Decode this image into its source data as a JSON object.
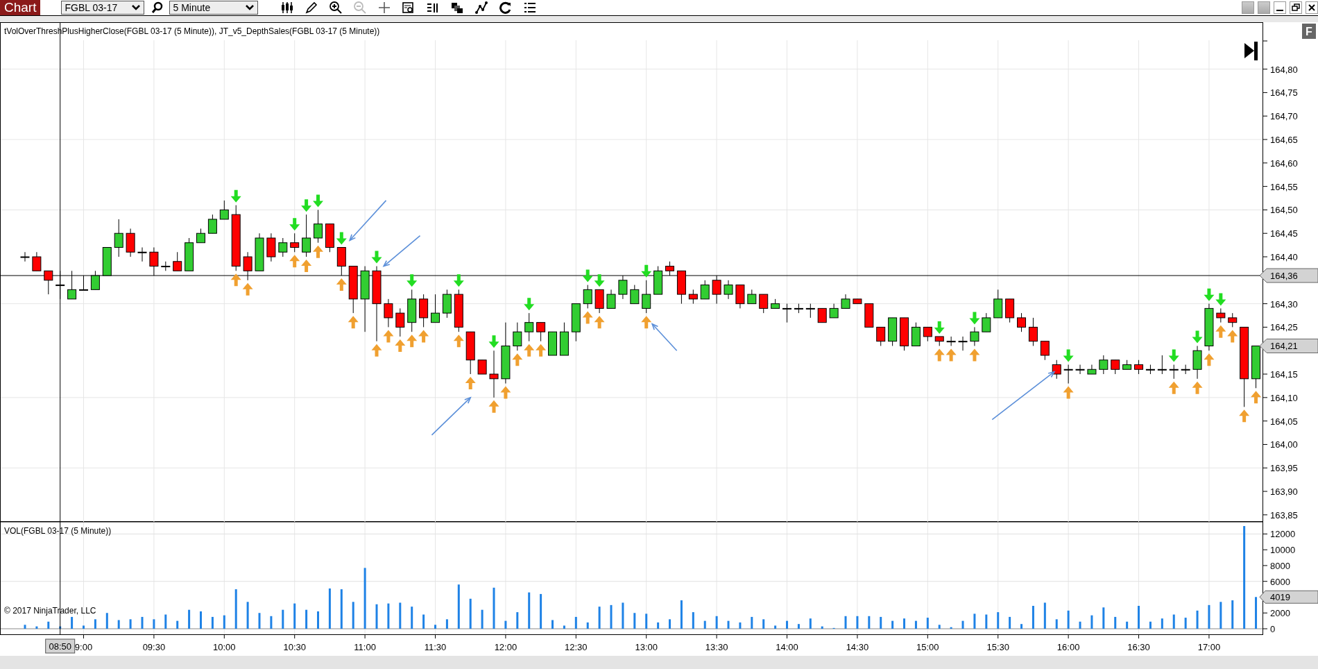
{
  "toolbar": {
    "tab": "Chart",
    "instrument": "FGBL 03-17",
    "interval": "5 Minute",
    "zoom_out_disabled": true
  },
  "badge": "F",
  "price_panel": {
    "title": "tVolOverThreshPlusHigherClose(FGBL 03-17 (5 Minute)), JT_v5_DepthSales(FGBL 03-17 (5 Minute))",
    "last_price_label": "164,21",
    "signal_down": [
      false,
      false,
      false,
      false,
      false,
      false,
      false,
      false,
      false,
      false,
      false,
      false,
      false,
      false,
      false,
      false,
      false,
      false,
      true,
      false,
      false,
      false,
      false,
      true,
      true,
      true,
      false,
      true,
      false,
      false,
      true,
      false,
      false,
      true,
      false,
      false,
      false,
      true,
      false,
      false,
      true,
      false,
      false,
      true,
      false,
      false,
      false,
      false,
      true,
      true,
      false,
      false,
      false,
      true,
      false,
      false,
      false,
      false,
      false,
      false,
      false,
      false,
      false,
      false,
      false,
      false,
      false,
      false,
      false,
      false,
      false,
      false,
      false,
      false,
      false,
      false,
      false,
      false,
      true,
      false,
      false,
      true,
      false,
      false,
      false,
      false,
      false,
      false,
      false,
      true,
      false,
      false,
      false,
      false,
      false,
      false,
      false,
      false,
      true,
      false,
      true,
      true,
      true,
      false,
      false,
      false
    ],
    "signal_up": [
      false,
      false,
      false,
      false,
      false,
      false,
      false,
      false,
      false,
      false,
      false,
      false,
      false,
      false,
      false,
      false,
      false,
      false,
      true,
      true,
      false,
      false,
      false,
      true,
      true,
      true,
      false,
      true,
      true,
      false,
      true,
      true,
      true,
      true,
      true,
      false,
      false,
      true,
      true,
      false,
      true,
      true,
      true,
      true,
      true,
      false,
      false,
      false,
      true,
      true,
      false,
      false,
      false,
      true,
      false,
      false,
      false,
      false,
      false,
      false,
      false,
      false,
      false,
      false,
      false,
      false,
      false,
      false,
      false,
      false,
      false,
      false,
      false,
      false,
      false,
      false,
      false,
      false,
      true,
      true,
      false,
      true,
      false,
      false,
      false,
      false,
      false,
      false,
      false,
      true,
      false,
      false,
      false,
      false,
      false,
      false,
      false,
      false,
      true,
      false,
      true,
      true,
      true,
      true,
      true,
      true
    ],
    "chart_data": {
      "type": "candlestick",
      "grid": true,
      "ylim": [
        163.835,
        164.9
      ],
      "x": [
        515,
        520,
        525,
        530,
        535,
        540,
        545,
        550,
        555,
        560,
        565,
        570,
        575,
        580,
        585,
        590,
        595,
        600,
        605,
        610,
        615,
        620,
        625,
        630,
        635,
        640,
        645,
        650,
        655,
        660,
        665,
        670,
        675,
        680,
        685,
        690,
        695,
        700,
        705,
        710,
        715,
        720,
        725,
        730,
        735,
        740,
        745,
        750,
        755,
        760,
        765,
        770,
        775,
        780,
        785,
        790,
        795,
        800,
        805,
        810,
        815,
        820,
        825,
        830,
        835,
        840,
        845,
        850,
        855,
        860,
        865,
        870,
        875,
        880,
        885,
        890,
        895,
        900,
        905,
        910,
        915,
        920,
        925,
        930,
        935,
        940,
        945,
        950,
        955,
        960,
        965,
        970,
        975,
        980,
        985,
        990,
        995,
        1000,
        1005,
        1010,
        1015,
        1020,
        1025,
        1030,
        1035,
        1040
      ],
      "ohlc": [
        [
          164.4,
          164.41,
          164.39,
          164.4
        ],
        [
          164.4,
          164.41,
          164.37,
          164.37
        ],
        [
          164.37,
          164.37,
          164.32,
          164.35
        ],
        [
          164.34,
          164.37,
          164.31,
          164.34
        ],
        [
          164.31,
          164.37,
          164.31,
          164.33
        ],
        [
          164.33,
          164.36,
          164.33,
          164.33
        ],
        [
          164.33,
          164.37,
          164.33,
          164.36
        ],
        [
          164.36,
          164.42,
          164.36,
          164.42
        ],
        [
          164.42,
          164.48,
          164.4,
          164.45
        ],
        [
          164.45,
          164.46,
          164.4,
          164.41
        ],
        [
          164.41,
          164.42,
          164.39,
          164.41
        ],
        [
          164.41,
          164.42,
          164.36,
          164.38
        ],
        [
          164.38,
          164.39,
          164.37,
          164.38
        ],
        [
          164.39,
          164.41,
          164.37,
          164.37
        ],
        [
          164.37,
          164.44,
          164.37,
          164.43
        ],
        [
          164.43,
          164.46,
          164.43,
          164.45
        ],
        [
          164.45,
          164.49,
          164.45,
          164.48
        ],
        [
          164.48,
          164.52,
          164.48,
          164.5
        ],
        [
          164.49,
          164.51,
          164.37,
          164.38
        ],
        [
          164.4,
          164.41,
          164.35,
          164.37
        ],
        [
          164.37,
          164.45,
          164.37,
          164.44
        ],
        [
          164.44,
          164.45,
          164.39,
          164.4
        ],
        [
          164.41,
          164.44,
          164.4,
          164.43
        ],
        [
          164.43,
          164.45,
          164.41,
          164.42
        ],
        [
          164.41,
          164.49,
          164.4,
          164.44
        ],
        [
          164.44,
          164.5,
          164.43,
          164.47
        ],
        [
          164.47,
          164.47,
          164.41,
          164.42
        ],
        [
          164.42,
          164.42,
          164.36,
          164.38
        ],
        [
          164.38,
          164.38,
          164.28,
          164.31
        ],
        [
          164.31,
          164.38,
          164.24,
          164.37
        ],
        [
          164.37,
          164.38,
          164.22,
          164.3
        ],
        [
          164.3,
          164.31,
          164.25,
          164.27
        ],
        [
          164.28,
          164.29,
          164.23,
          164.25
        ],
        [
          164.26,
          164.33,
          164.24,
          164.31
        ],
        [
          164.31,
          164.32,
          164.25,
          164.27
        ],
        [
          164.26,
          164.32,
          164.26,
          164.28
        ],
        [
          164.28,
          164.33,
          164.27,
          164.32
        ],
        [
          164.32,
          164.33,
          164.24,
          164.25
        ],
        [
          164.24,
          164.24,
          164.15,
          164.18
        ],
        [
          164.18,
          164.18,
          164.15,
          164.15
        ],
        [
          164.15,
          164.2,
          164.1,
          164.14
        ],
        [
          164.14,
          164.26,
          164.13,
          164.21
        ],
        [
          164.21,
          164.26,
          164.2,
          164.24
        ],
        [
          164.24,
          164.28,
          164.22,
          164.26
        ],
        [
          164.26,
          164.26,
          164.22,
          164.24
        ],
        [
          164.19,
          164.24,
          164.19,
          164.24
        ],
        [
          164.19,
          164.26,
          164.19,
          164.24
        ],
        [
          164.24,
          164.3,
          164.22,
          164.3
        ],
        [
          164.3,
          164.34,
          164.29,
          164.33
        ],
        [
          164.33,
          164.33,
          164.28,
          164.29
        ],
        [
          164.29,
          164.33,
          164.29,
          164.32
        ],
        [
          164.32,
          164.36,
          164.31,
          164.35
        ],
        [
          164.3,
          164.34,
          164.3,
          164.33
        ],
        [
          164.29,
          164.35,
          164.28,
          164.32
        ],
        [
          164.32,
          164.38,
          164.32,
          164.37
        ],
        [
          164.38,
          164.39,
          164.36,
          164.37
        ],
        [
          164.37,
          164.37,
          164.3,
          164.32
        ],
        [
          164.32,
          164.33,
          164.3,
          164.31
        ],
        [
          164.31,
          164.35,
          164.31,
          164.34
        ],
        [
          164.35,
          164.36,
          164.3,
          164.32
        ],
        [
          164.32,
          164.35,
          164.31,
          164.34
        ],
        [
          164.34,
          164.34,
          164.29,
          164.3
        ],
        [
          164.3,
          164.33,
          164.3,
          164.32
        ],
        [
          164.32,
          164.32,
          164.28,
          164.29
        ],
        [
          164.29,
          164.31,
          164.29,
          164.3
        ],
        [
          164.29,
          164.3,
          164.26,
          164.29
        ],
        [
          164.29,
          164.3,
          164.28,
          164.29
        ],
        [
          164.29,
          164.3,
          164.27,
          164.29
        ],
        [
          164.29,
          164.29,
          164.26,
          164.26
        ],
        [
          164.27,
          164.3,
          164.27,
          164.29
        ],
        [
          164.29,
          164.32,
          164.29,
          164.31
        ],
        [
          164.31,
          164.31,
          164.3,
          164.3
        ],
        [
          164.3,
          164.3,
          164.25,
          164.25
        ],
        [
          164.25,
          164.25,
          164.21,
          164.22
        ],
        [
          164.22,
          164.27,
          164.21,
          164.27
        ],
        [
          164.27,
          164.27,
          164.2,
          164.21
        ],
        [
          164.21,
          164.26,
          164.21,
          164.25
        ],
        [
          164.25,
          164.25,
          164.22,
          164.23
        ],
        [
          164.23,
          164.23,
          164.21,
          164.22
        ],
        [
          164.22,
          164.23,
          164.21,
          164.22
        ],
        [
          164.22,
          164.23,
          164.2,
          164.22
        ],
        [
          164.22,
          164.25,
          164.21,
          164.24
        ],
        [
          164.24,
          164.28,
          164.24,
          164.27
        ],
        [
          164.27,
          164.33,
          164.27,
          164.31
        ],
        [
          164.31,
          164.31,
          164.26,
          164.27
        ],
        [
          164.27,
          164.28,
          164.24,
          164.25
        ],
        [
          164.25,
          164.27,
          164.21,
          164.22
        ],
        [
          164.22,
          164.22,
          164.18,
          164.19
        ],
        [
          164.17,
          164.18,
          164.14,
          164.15
        ],
        [
          164.16,
          164.17,
          164.13,
          164.16
        ],
        [
          164.16,
          164.17,
          164.15,
          164.16
        ],
        [
          164.15,
          164.17,
          164.15,
          164.16
        ],
        [
          164.16,
          164.19,
          164.15,
          164.18
        ],
        [
          164.18,
          164.18,
          164.15,
          164.16
        ],
        [
          164.16,
          164.18,
          164.16,
          164.17
        ],
        [
          164.17,
          164.18,
          164.15,
          164.16
        ],
        [
          164.16,
          164.17,
          164.15,
          164.16
        ],
        [
          164.16,
          164.19,
          164.15,
          164.16
        ],
        [
          164.16,
          164.17,
          164.14,
          164.16
        ],
        [
          164.16,
          164.17,
          164.15,
          164.16
        ],
        [
          164.16,
          164.21,
          164.14,
          164.2
        ],
        [
          164.21,
          164.3,
          164.2,
          164.29
        ],
        [
          164.28,
          164.29,
          164.26,
          164.27
        ],
        [
          164.27,
          164.28,
          164.25,
          164.26
        ],
        [
          164.25,
          164.25,
          164.08,
          164.14
        ],
        [
          164.14,
          164.21,
          164.12,
          164.21
        ]
      ],
      "ref_lines": [
        {
          "axis": "y",
          "value": 164.36,
          "label": "164,36"
        },
        {
          "axis": "x",
          "value": 530
        }
      ],
      "xlim": [
        504.35,
        1042.8
      ],
      "yticks": [
        {
          "value": 164.8,
          "label": "164,80"
        },
        {
          "value": 164.75,
          "label": "164,75"
        },
        {
          "value": 164.7,
          "label": "164,70"
        },
        {
          "value": 164.65,
          "label": "164,65"
        },
        {
          "value": 164.6,
          "label": "164,60"
        },
        {
          "value": 164.55,
          "label": "164,55"
        },
        {
          "value": 164.5,
          "label": "164,50"
        },
        {
          "value": 164.45,
          "label": "164,45"
        },
        {
          "value": 164.4,
          "label": "164,40"
        },
        {
          "value": 164.3,
          "label": "164,30"
        },
        {
          "value": 164.25,
          "label": "164,25"
        },
        {
          "value": 164.15,
          "label": "164,15"
        },
        {
          "value": 164.1,
          "label": "164,10"
        },
        {
          "value": 164.05,
          "label": "164,05"
        },
        {
          "value": 164.0,
          "label": "164,00"
        },
        {
          "value": 163.95,
          "label": "163,95"
        },
        {
          "value": 163.9,
          "label": "163,90"
        },
        {
          "value": 163.85,
          "label": "163,85"
        }
      ]
    }
  },
  "volume_panel": {
    "title": "VOL(FGBL 03-17 (5 Minute))",
    "copyright": "© 2017 NinjaTrader, LLC",
    "last_label": "4019",
    "crosshair_time": "08:50",
    "chart_data": {
      "type": "bar",
      "grid": true,
      "ylim": [
        -790,
        13530
      ],
      "xlim": [
        504.35,
        1042.8
      ],
      "x": [
        515,
        520,
        525,
        530,
        535,
        540,
        545,
        550,
        555,
        560,
        565,
        570,
        575,
        580,
        585,
        590,
        595,
        600,
        605,
        610,
        615,
        620,
        625,
        630,
        635,
        640,
        645,
        650,
        655,
        660,
        665,
        670,
        675,
        680,
        685,
        690,
        695,
        700,
        705,
        710,
        715,
        720,
        725,
        730,
        735,
        740,
        745,
        750,
        755,
        760,
        765,
        770,
        775,
        780,
        785,
        790,
        795,
        800,
        805,
        810,
        815,
        820,
        825,
        830,
        835,
        840,
        845,
        850,
        855,
        860,
        865,
        870,
        875,
        880,
        885,
        890,
        895,
        900,
        905,
        910,
        915,
        920,
        925,
        930,
        935,
        940,
        945,
        950,
        955,
        960,
        965,
        970,
        975,
        980,
        985,
        990,
        995,
        1000,
        1005,
        1010,
        1015,
        1020,
        1025,
        1030,
        1035,
        1040
      ],
      "values": [
        500,
        300,
        900,
        300,
        1500,
        400,
        1200,
        2000,
        1100,
        1200,
        1500,
        1200,
        1800,
        1000,
        2400,
        2200,
        1500,
        1700,
        5000,
        3400,
        2000,
        1600,
        2400,
        3200,
        2400,
        2200,
        5100,
        5000,
        3400,
        7700,
        3100,
        3200,
        3300,
        2800,
        1800,
        500,
        1200,
        5600,
        3800,
        2400,
        5200,
        1000,
        2100,
        4600,
        4400,
        1100,
        400,
        1500,
        800,
        2800,
        3000,
        3300,
        2000,
        1900,
        800,
        1200,
        3600,
        2100,
        1000,
        1600,
        1000,
        800,
        1500,
        1200,
        400,
        1000,
        600,
        1300,
        300,
        100,
        1600,
        1600,
        1600,
        1500,
        1000,
        1300,
        1000,
        1400,
        500,
        200,
        1000,
        1900,
        1800,
        2100,
        1500,
        600,
        2900,
        3300,
        1200,
        2300,
        900,
        1700,
        2700,
        1500,
        900,
        2900,
        900,
        1300,
        1800,
        1400,
        2300,
        3000,
        3400,
        3600,
        13000,
        4019
      ],
      "ref_lines": [
        {
          "axis": "x",
          "value": 530
        }
      ],
      "yticks": [
        {
          "value": 0,
          "label": "0"
        },
        {
          "value": 2000,
          "label": "2000"
        },
        {
          "value": 6000,
          "label": "6000"
        },
        {
          "value": 8000,
          "label": "8000"
        },
        {
          "value": 10000,
          "label": "10000"
        },
        {
          "value": 12000,
          "label": "12000"
        }
      ],
      "xticks": [
        {
          "value": 540,
          "label": "9:00"
        },
        {
          "value": 570,
          "label": "09:30"
        },
        {
          "value": 600,
          "label": "10:00"
        },
        {
          "value": 630,
          "label": "10:30"
        },
        {
          "value": 660,
          "label": "11:00"
        },
        {
          "value": 690,
          "label": "11:30"
        },
        {
          "value": 720,
          "label": "12:00"
        },
        {
          "value": 750,
          "label": "12:30"
        },
        {
          "value": 780,
          "label": "13:00"
        },
        {
          "value": 810,
          "label": "13:30"
        },
        {
          "value": 840,
          "label": "14:00"
        },
        {
          "value": 870,
          "label": "14:30"
        },
        {
          "value": 900,
          "label": "15:00"
        },
        {
          "value": 930,
          "label": "15:30"
        },
        {
          "value": 960,
          "label": "16:00"
        },
        {
          "value": 990,
          "label": "16:30"
        },
        {
          "value": 1020,
          "label": "17:00"
        }
      ]
    }
  }
}
